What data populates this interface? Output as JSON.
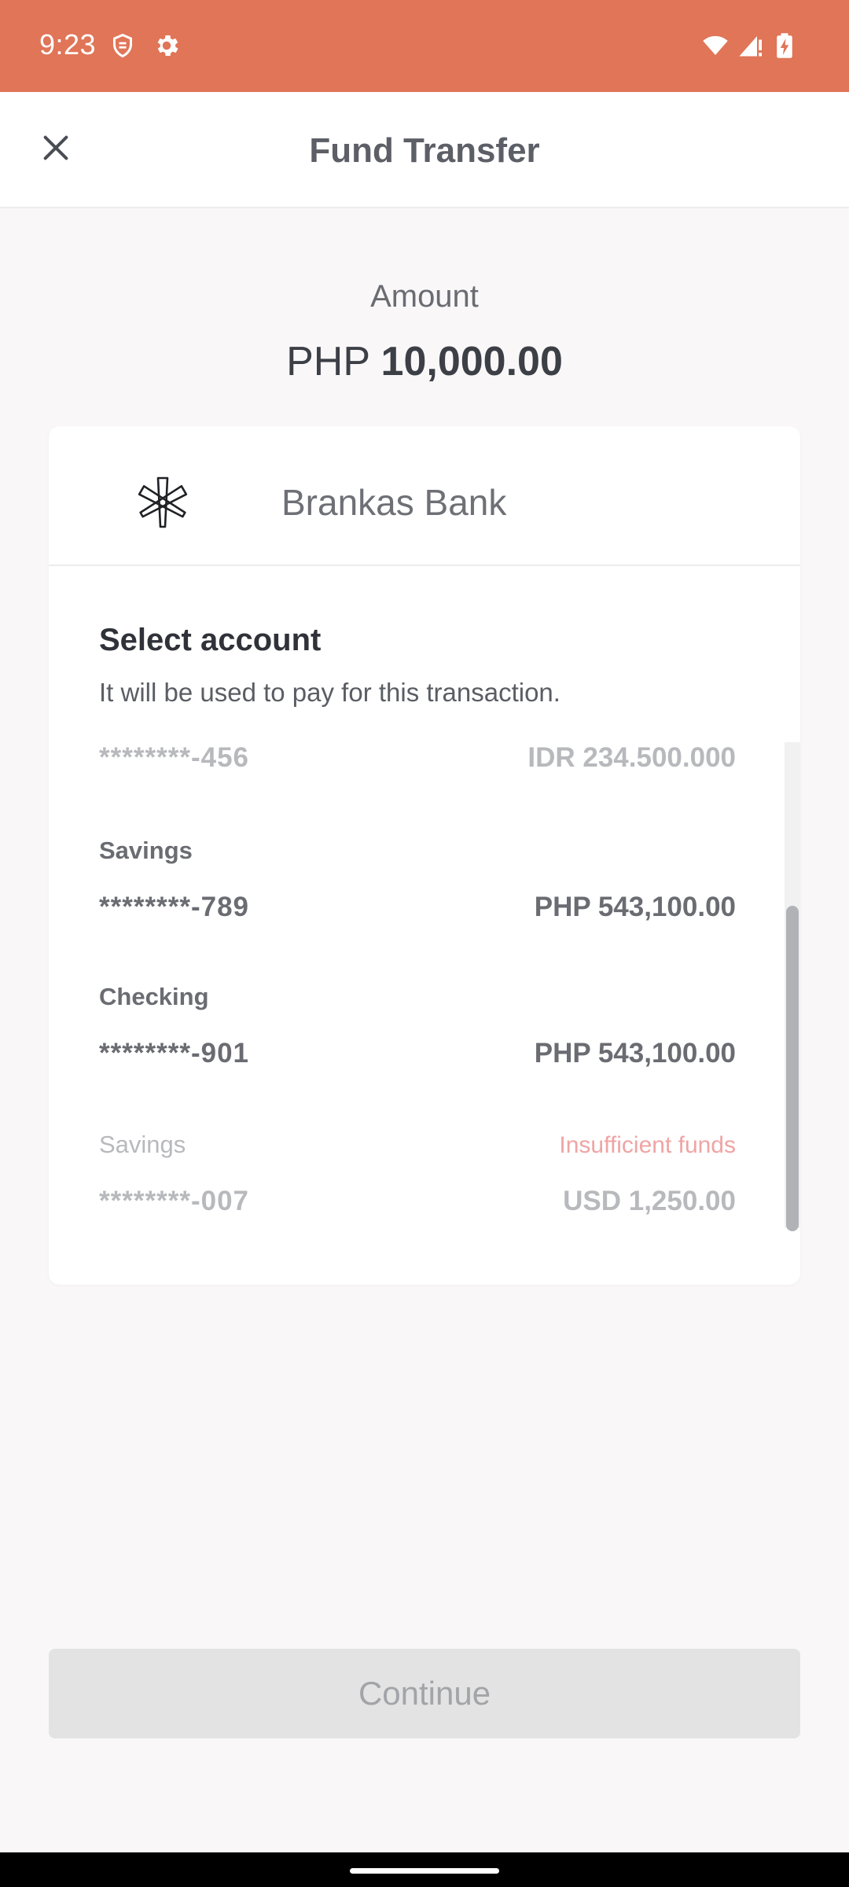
{
  "status_bar": {
    "time": "9:23",
    "icons": [
      "shield-check-icon",
      "gear-icon",
      "wifi-icon",
      "cellular-signal-icon",
      "battery-charging-icon"
    ],
    "background_color": "#e07558"
  },
  "app_bar": {
    "title": "Fund Transfer",
    "close_icon": "close-icon"
  },
  "amount": {
    "label": "Amount",
    "currency": "PHP",
    "value": "10,000.00"
  },
  "bank": {
    "name": "Brankas Bank",
    "logo_icon": "brankas-logo-icon"
  },
  "account_selection": {
    "title": "Select account",
    "subtitle": "It will be used to pay for this transaction.",
    "accounts": [
      {
        "type": "",
        "number": "********-456",
        "balance": "IDR 234.500.000",
        "status": "",
        "enabled": false
      },
      {
        "type": "Savings",
        "number": "********-789",
        "balance": "PHP 543,100.00",
        "status": "",
        "enabled": true
      },
      {
        "type": "Checking",
        "number": "********-901",
        "balance": "PHP 543,100.00",
        "status": "",
        "enabled": true
      },
      {
        "type": "Savings",
        "number": "********-007",
        "balance": "USD 1,250.00",
        "status": "Insufficient funds",
        "enabled": false
      }
    ]
  },
  "footer": {
    "continue_label": "Continue",
    "continue_enabled": false
  },
  "colors": {
    "accent": "#e07558",
    "warning_text": "#f0a4a4",
    "disabled_button": "#e3e3e3"
  }
}
